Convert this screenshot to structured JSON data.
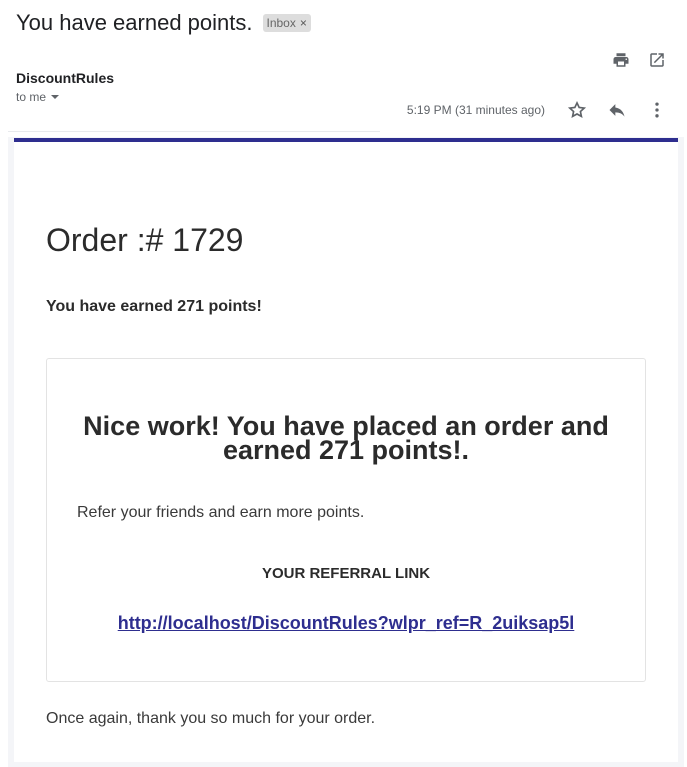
{
  "header": {
    "subject": "You have earned points.",
    "label": "Inbox",
    "label_close": "×"
  },
  "sender": {
    "name": "DiscountRules",
    "recipient": "to me",
    "timestamp": "5:19 PM (31 minutes ago)"
  },
  "icons": {
    "print": "print-icon",
    "open_new_window": "open-in-new-icon",
    "star": "star-icon",
    "reply": "reply-icon",
    "more": "more-vert-icon",
    "dropdown": "caret-down-icon"
  },
  "email": {
    "order_title": "Order :# 1729",
    "earned_line": "You have earned 271 points!",
    "nice_work": "Nice work! You have placed an order and earned 271 points!.",
    "refer_text": "Refer your friends and earn more points.",
    "referral_heading": "YOUR REFERRAL LINK",
    "referral_link": "http://localhost/DiscountRules?wlpr_ref=R_2uiksap5l",
    "thanks": "Once again, thank you so much for your order."
  },
  "colors": {
    "accent": "#2e2e8f",
    "text": "#2b2b2b",
    "muted": "#5f6368"
  }
}
